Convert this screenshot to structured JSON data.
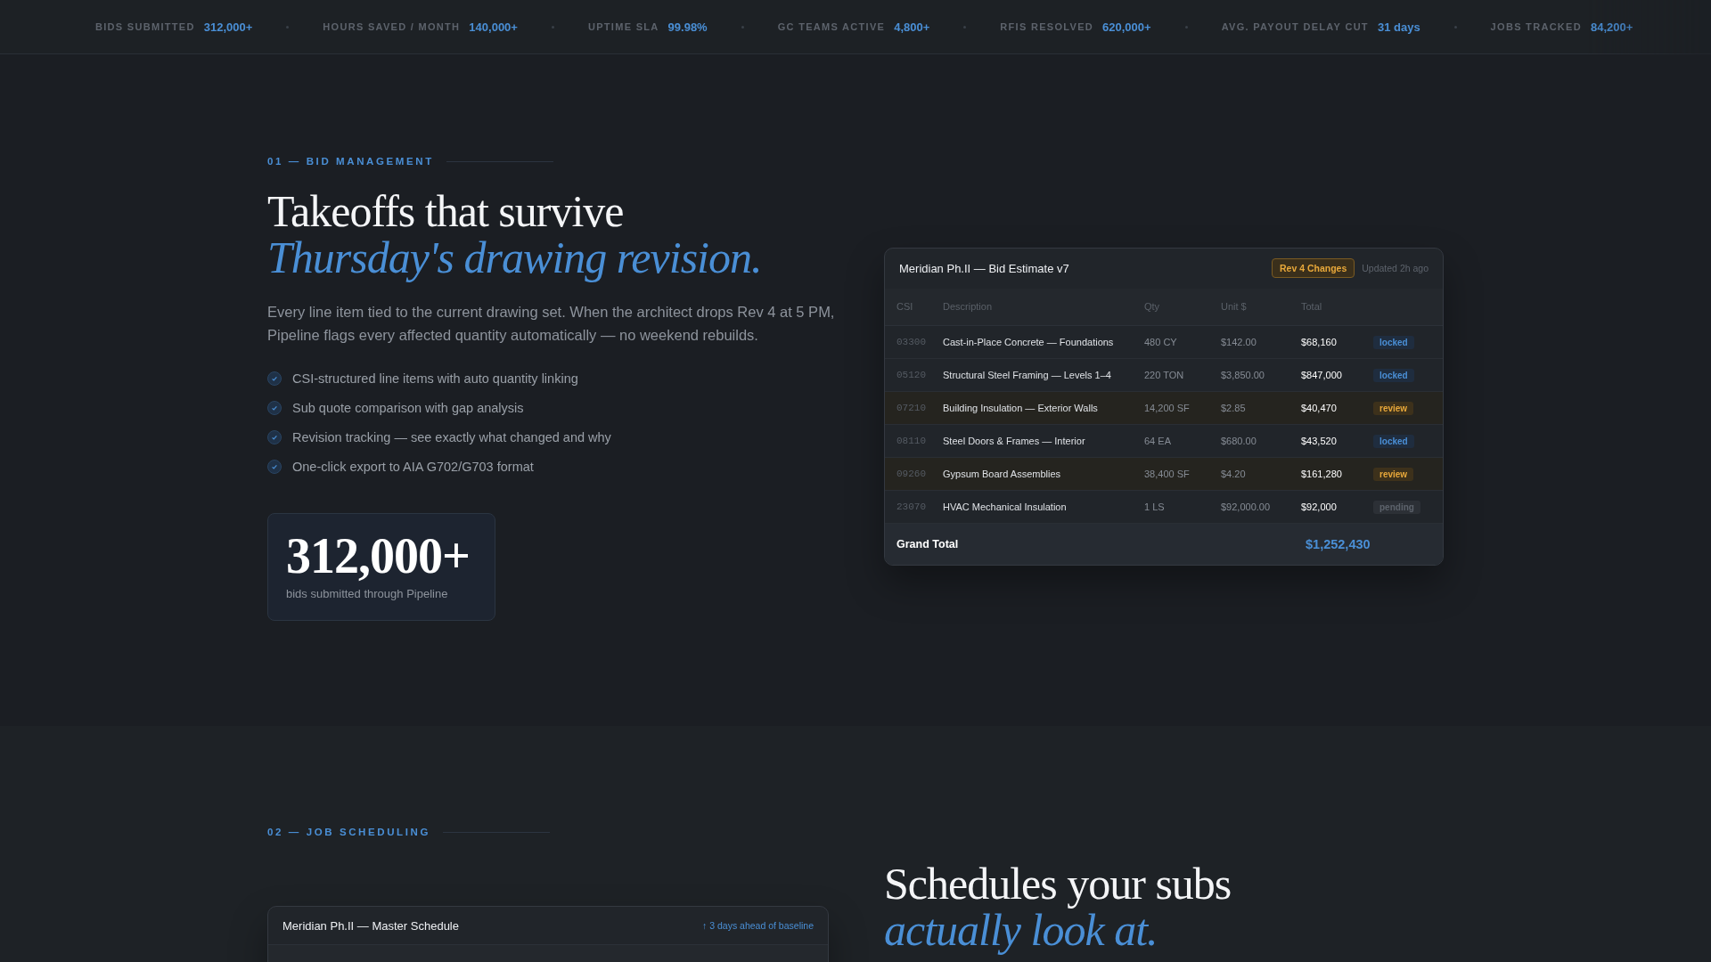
{
  "ticker": [
    {
      "label": "BIDS SUBMITTED",
      "value": "312,000+"
    },
    {
      "label": "HOURS SAVED / MONTH",
      "value": "140,000+"
    },
    {
      "label": "UPTIME SLA",
      "value": "99.98%"
    },
    {
      "label": "GC TEAMS ACTIVE",
      "value": "4,800+"
    },
    {
      "label": "RFIS RESOLVED",
      "value": "620,000+"
    },
    {
      "label": "AVG. PAYOUT DELAY CUT",
      "value": "31 days"
    },
    {
      "label": "JOBS TRACKED",
      "value": "84,200+"
    }
  ],
  "bid_section": {
    "eyebrow": "01 — BID MANAGEMENT",
    "headline": "Takeoffs that survive",
    "headline_accent": "Thursday's drawing revision.",
    "body": "Every line item tied to the current drawing set. When the architect drops Rev 4 at 5 PM, Pipeline flags every affected quantity automatically — no weekend rebuilds.",
    "features": [
      "CSI-structured line items with auto quantity linking",
      "Sub quote comparison with gap analysis",
      "Revision tracking — see exactly what changed and why",
      "One-click export to AIA G702/G703 format"
    ],
    "stat": {
      "value": "312,000+",
      "caption": "bids submitted through Pipeline"
    },
    "estimate": {
      "title": "Meridian Ph.II — Bid Estimate v7",
      "badge": "Rev 4 Changes",
      "updated": "Updated 2h ago",
      "columns": [
        "CSI",
        "Description",
        "Qty",
        "Unit $",
        "Total"
      ],
      "rows": [
        {
          "csi": "03300",
          "description": "Cast-in-Place Concrete — Foundations",
          "qty": "480 CY",
          "unit": "$142.00",
          "total": "$68,160",
          "status": "locked"
        },
        {
          "csi": "05120",
          "description": "Structural Steel Framing — Levels 1–4",
          "qty": "220 TON",
          "unit": "$3,850.00",
          "total": "$847,000",
          "status": "locked"
        },
        {
          "csi": "07210",
          "description": "Building Insulation — Exterior Walls",
          "qty": "14,200 SF",
          "unit": "$2.85",
          "total": "$40,470",
          "status": "review"
        },
        {
          "csi": "08110",
          "description": "Steel Doors & Frames — Interior",
          "qty": "64 EA",
          "unit": "$680.00",
          "total": "$43,520",
          "status": "locked"
        },
        {
          "csi": "09260",
          "description": "Gypsum Board Assemblies",
          "qty": "38,400 SF",
          "unit": "$4.20",
          "total": "$161,280",
          "status": "review"
        },
        {
          "csi": "23070",
          "description": "HVAC Mechanical Insulation",
          "qty": "1 LS",
          "unit": "$92,000.00",
          "total": "$92,000",
          "status": "pending"
        }
      ],
      "grand_total_label": "Grand Total",
      "grand_total": "$1,252,430"
    }
  },
  "schedule_section": {
    "eyebrow": "02 — JOB SCHEDULING",
    "headline": "Schedules your subs",
    "headline_accent": "actually look at.",
    "schedule": {
      "title": "Meridian Ph.II — Master Schedule",
      "note": "↑ 3 days ahead of baseline"
    }
  }
}
